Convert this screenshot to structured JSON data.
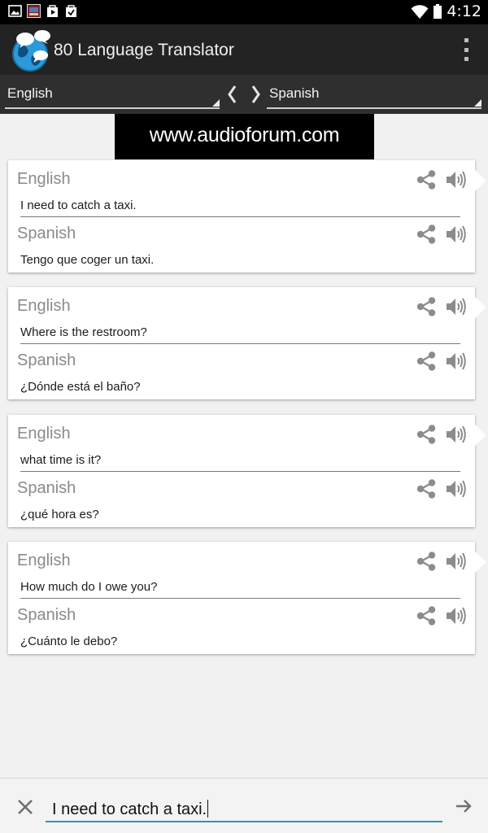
{
  "status_bar": {
    "time": "4:12",
    "left_icons": [
      "image-icon",
      "app-thumbnail-icon",
      "play-store-icon",
      "clipboard-check-icon"
    ],
    "right_icons": [
      "wifi-icon",
      "battery-icon"
    ]
  },
  "action_bar": {
    "title": "80 Language Translator",
    "logo_icon": "globe-speech-logo-icon",
    "menu_icon": "overflow-menu-icon"
  },
  "language_bar": {
    "source_language": "English",
    "target_language": "Spanish",
    "swap_icon": "swap-chevrons-icon"
  },
  "banner": {
    "text": "www.audioforum.com"
  },
  "translations": [
    {
      "source_label": "English",
      "source_text": "I need to catch a taxi.",
      "target_label": "Spanish",
      "target_text": "Tengo que coger un taxi."
    },
    {
      "source_label": "English",
      "source_text": "Where is the restroom?",
      "target_label": "Spanish",
      "target_text": "¿Dónde está el baño?"
    },
    {
      "source_label": "English",
      "source_text": "what time is it?",
      "target_label": "Spanish",
      "target_text": "¿qué hora es?"
    },
    {
      "source_label": "English",
      "source_text": "How much do I owe you?",
      "target_label": "Spanish",
      "target_text": "¿Cuánto le debo?"
    }
  ],
  "input_bar": {
    "value": "I need to catch a taxi.",
    "clear_icon": "close-icon",
    "send_icon": "arrow-right-icon"
  },
  "colors": {
    "status_bar": "#000000",
    "action_bar": "#232323",
    "language_bar": "#2f2f2f",
    "background": "#f1f1f1",
    "card": "#ffffff",
    "label_gray": "#8a8a8a",
    "input_underline": "#2a96b8"
  }
}
